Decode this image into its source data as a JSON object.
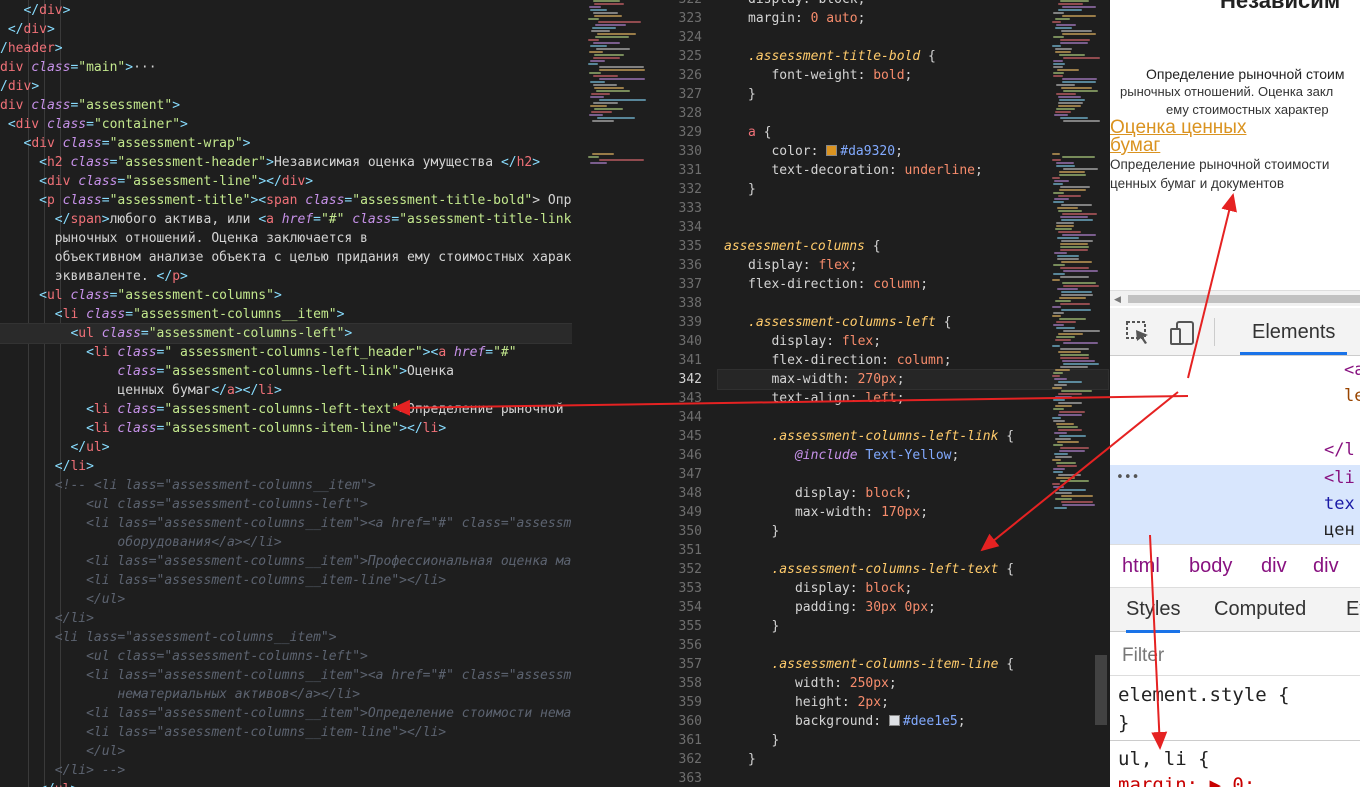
{
  "html_editor": {
    "lines": [
      [
        {
          "t": "   </",
          "c": "pun"
        },
        {
          "t": "div",
          "c": "tag"
        },
        {
          "t": ">",
          "c": "pun"
        }
      ],
      [
        {
          "t": " </",
          "c": "pun"
        },
        {
          "t": "div",
          "c": "tag"
        },
        {
          "t": ">",
          "c": "pun"
        }
      ],
      [
        {
          "t": "/",
          "c": "pun"
        },
        {
          "t": "header",
          "c": "tag"
        },
        {
          "t": ">",
          "c": "pun"
        }
      ],
      [
        {
          "t": "div",
          "c": "tag"
        },
        {
          "t": " class",
          "c": "attr"
        },
        {
          "t": "=",
          "c": "pun"
        },
        {
          "t": "\"main\"",
          "c": "str"
        },
        {
          "t": ">",
          "c": "pun"
        },
        {
          "t": "···",
          "c": "txt"
        }
      ],
      [
        {
          "t": "/",
          "c": "pun"
        },
        {
          "t": "div",
          "c": "tag"
        },
        {
          "t": ">",
          "c": "pun"
        }
      ],
      [
        {
          "t": "div",
          "c": "tag"
        },
        {
          "t": " class",
          "c": "attr"
        },
        {
          "t": "=",
          "c": "pun"
        },
        {
          "t": "\"assessment\"",
          "c": "str"
        },
        {
          "t": ">",
          "c": "pun"
        }
      ],
      [
        {
          "t": " <",
          "c": "pun"
        },
        {
          "t": "div",
          "c": "tag"
        },
        {
          "t": " class",
          "c": "attr"
        },
        {
          "t": "=",
          "c": "pun"
        },
        {
          "t": "\"container\"",
          "c": "str"
        },
        {
          "t": ">",
          "c": "pun"
        }
      ],
      [
        {
          "t": "   <",
          "c": "pun"
        },
        {
          "t": "div",
          "c": "tag"
        },
        {
          "t": " class",
          "c": "attr"
        },
        {
          "t": "=",
          "c": "pun"
        },
        {
          "t": "\"assessment-wrap\"",
          "c": "str"
        },
        {
          "t": ">",
          "c": "pun"
        }
      ],
      [
        {
          "t": "     <",
          "c": "pun"
        },
        {
          "t": "h2",
          "c": "tag"
        },
        {
          "t": " class",
          "c": "attr"
        },
        {
          "t": "=",
          "c": "pun"
        },
        {
          "t": "\"assessment-header\"",
          "c": "str"
        },
        {
          "t": ">",
          "c": "pun"
        },
        {
          "t": "Независимая оценка умущества ",
          "c": "txt"
        },
        {
          "t": "</",
          "c": "pun"
        },
        {
          "t": "h2",
          "c": "tag"
        },
        {
          "t": ">",
          "c": "pun"
        }
      ],
      [
        {
          "t": "     <",
          "c": "pun"
        },
        {
          "t": "div",
          "c": "tag"
        },
        {
          "t": " class",
          "c": "attr"
        },
        {
          "t": "=",
          "c": "pun"
        },
        {
          "t": "\"assessment-line\"",
          "c": "str"
        },
        {
          "t": "></",
          "c": "pun"
        },
        {
          "t": "div",
          "c": "tag"
        },
        {
          "t": ">",
          "c": "pun"
        }
      ],
      [
        {
          "t": "     <",
          "c": "pun"
        },
        {
          "t": "p",
          "c": "tag"
        },
        {
          "t": " class",
          "c": "attr"
        },
        {
          "t": "=",
          "c": "pun"
        },
        {
          "t": "\"assessment-title\"",
          "c": "str"
        },
        {
          "t": "><",
          "c": "pun"
        },
        {
          "t": "span",
          "c": "tag"
        },
        {
          "t": " class",
          "c": "attr"
        },
        {
          "t": "=",
          "c": "pun"
        },
        {
          "t": "\"assessment-title-bold\"",
          "c": "str"
        },
        {
          "t": "> Опре",
          "c": "txt"
        }
      ],
      [
        {
          "t": "       </",
          "c": "pun"
        },
        {
          "t": "span",
          "c": "tag"
        },
        {
          "t": ">",
          "c": "pun"
        },
        {
          "t": "любого актива, или ",
          "c": "txt"
        },
        {
          "t": "<",
          "c": "pun"
        },
        {
          "t": "a",
          "c": "tag"
        },
        {
          "t": " href",
          "c": "attr"
        },
        {
          "t": "=",
          "c": "pun"
        },
        {
          "t": "\"#\"",
          "c": "str"
        },
        {
          "t": " class",
          "c": "attr"
        },
        {
          "t": "=",
          "c": "pun"
        },
        {
          "t": "\"assessment-title-link\"",
          "c": "str"
        }
      ],
      [
        {
          "t": "       рыночных отношений. Оценка заключается в",
          "c": "txt"
        }
      ],
      [
        {
          "t": "       объективном анализе объекта с целью придания ему стоимостных характ",
          "c": "txt"
        }
      ],
      [
        {
          "t": "       эквиваленте. ",
          "c": "txt"
        },
        {
          "t": "</",
          "c": "pun"
        },
        {
          "t": "p",
          "c": "tag"
        },
        {
          "t": ">",
          "c": "pun"
        }
      ],
      [
        {
          "t": "     <",
          "c": "pun"
        },
        {
          "t": "ul",
          "c": "tag"
        },
        {
          "t": " class",
          "c": "attr"
        },
        {
          "t": "=",
          "c": "pun"
        },
        {
          "t": "\"assessment-columns\"",
          "c": "str"
        },
        {
          "t": ">",
          "c": "pun"
        }
      ],
      [
        {
          "t": "       <",
          "c": "pun"
        },
        {
          "t": "li",
          "c": "tag"
        },
        {
          "t": " class",
          "c": "attr"
        },
        {
          "t": "=",
          "c": "pun"
        },
        {
          "t": "\"assessment-columns__item\"",
          "c": "str"
        },
        {
          "t": ">",
          "c": "pun"
        }
      ],
      [
        {
          "t": "         <",
          "c": "pun"
        },
        {
          "t": "ul",
          "c": "tag"
        },
        {
          "t": " class",
          "c": "attr"
        },
        {
          "t": "=",
          "c": "pun"
        },
        {
          "t": "\"assessment-columns-left\"",
          "c": "str"
        },
        {
          "t": ">",
          "c": "pun"
        }
      ],
      [
        {
          "t": "           <",
          "c": "pun"
        },
        {
          "t": "li",
          "c": "tag"
        },
        {
          "t": " class",
          "c": "attr"
        },
        {
          "t": "=",
          "c": "pun"
        },
        {
          "t": "\" assessment-columns-left_header\"",
          "c": "str"
        },
        {
          "t": "><",
          "c": "pun"
        },
        {
          "t": "a",
          "c": "tag"
        },
        {
          "t": " href",
          "c": "attr"
        },
        {
          "t": "=",
          "c": "pun"
        },
        {
          "t": "\"#\"",
          "c": "str"
        }
      ],
      [
        {
          "t": "               class",
          "c": "attr"
        },
        {
          "t": "=",
          "c": "pun"
        },
        {
          "t": "\"assessment-columns-left-link\"",
          "c": "str"
        },
        {
          "t": ">",
          "c": "pun"
        },
        {
          "t": "Оценка",
          "c": "txt"
        }
      ],
      [
        {
          "t": "               ценных бумаг",
          "c": "txt"
        },
        {
          "t": "</",
          "c": "pun"
        },
        {
          "t": "a",
          "c": "tag"
        },
        {
          "t": "></",
          "c": "pun"
        },
        {
          "t": "li",
          "c": "tag"
        },
        {
          "t": ">",
          "c": "pun"
        }
      ],
      [
        {
          "t": "           <",
          "c": "pun"
        },
        {
          "t": "li",
          "c": "tag"
        },
        {
          "t": " class",
          "c": "attr"
        },
        {
          "t": "=",
          "c": "pun"
        },
        {
          "t": "\"assessment-columns-left-text\"",
          "c": "str"
        },
        {
          "t": ">",
          "c": "pun"
        },
        {
          "t": "Определение рыночной с",
          "c": "txt"
        }
      ],
      [
        {
          "t": "           <",
          "c": "pun"
        },
        {
          "t": "li",
          "c": "tag"
        },
        {
          "t": " class",
          "c": "attr"
        },
        {
          "t": "=",
          "c": "pun"
        },
        {
          "t": "\"assessment-columns-item-line\"",
          "c": "str"
        },
        {
          "t": "></",
          "c": "pun"
        },
        {
          "t": "li",
          "c": "tag"
        },
        {
          "t": ">",
          "c": "pun"
        }
      ],
      [
        {
          "t": "         </",
          "c": "pun"
        },
        {
          "t": "ul",
          "c": "tag"
        },
        {
          "t": ">",
          "c": "pun"
        }
      ],
      [
        {
          "t": "       </",
          "c": "pun"
        },
        {
          "t": "li",
          "c": "tag"
        },
        {
          "t": ">",
          "c": "pun"
        }
      ],
      [
        {
          "t": "       <!-- <li lass=\"assessment-columns__item\">",
          "c": "cm"
        }
      ],
      [
        {
          "t": "           <ul class=\"assessment-columns-left\">",
          "c": "cm"
        }
      ],
      [
        {
          "t": "           <li lass=\"assessment-columns__item\"><a href=\"#\" class=\"assessme",
          "c": "cm"
        }
      ],
      [
        {
          "t": "               оборудования</a></li>",
          "c": "cm"
        }
      ],
      [
        {
          "t": "           <li lass=\"assessment-columns__item\">Профессиональная оценка ма",
          "c": "cm"
        }
      ],
      [
        {
          "t": "           <li lass=\"assessment-columns__item-line\"></li>",
          "c": "cm"
        }
      ],
      [
        {
          "t": "           </ul>",
          "c": "cm"
        }
      ],
      [
        {
          "t": "       </li>",
          "c": "cm"
        }
      ],
      [
        {
          "t": "       <li lass=\"assessment-columns__item\">",
          "c": "cm"
        }
      ],
      [
        {
          "t": "           <ul class=\"assessment-columns-left\">",
          "c": "cm"
        }
      ],
      [
        {
          "t": "           <li lass=\"assessment-columns__item\"><a href=\"#\" class=\"assessme",
          "c": "cm"
        }
      ],
      [
        {
          "t": "               нематериальных активов</a></li>",
          "c": "cm"
        }
      ],
      [
        {
          "t": "           <li lass=\"assessment-columns__item\">Определение стоимости нема",
          "c": "cm"
        }
      ],
      [
        {
          "t": "           <li lass=\"assessment-columns__item-line\"></li>",
          "c": "cm"
        }
      ],
      [
        {
          "t": "           </ul>",
          "c": "cm"
        }
      ],
      [
        {
          "t": "       </li> -->",
          "c": "cm"
        }
      ],
      [
        {
          "t": "     </",
          "c": "pun"
        },
        {
          "t": "ul",
          "c": "tag"
        },
        {
          "t": ">",
          "c": "pun"
        }
      ]
    ],
    "highlighted_line": 17
  },
  "css_editor": {
    "line_numbers": [
      "322",
      "323",
      "324",
      "325",
      "326",
      "327",
      "328",
      "329",
      "330",
      "331",
      "332",
      "333",
      "334",
      "335",
      "336",
      "337",
      "338",
      "339",
      "340",
      "341",
      "342",
      "343",
      "344",
      "345",
      "346",
      "347",
      "348",
      "349",
      "350",
      "351",
      "352",
      "353",
      "354",
      "355",
      "356",
      "357",
      "358",
      "359",
      "360",
      "361",
      "362",
      "363"
    ],
    "current_line": "342",
    "lines": [
      [
        {
          "t": "display: block;",
          "c": "prop"
        }
      ],
      [
        {
          "t": "margin: ",
          "c": "prop"
        },
        {
          "t": "0 auto",
          "c": "val"
        },
        {
          "t": ";",
          "c": "prop"
        }
      ],
      [],
      [
        {
          "t": ".assessment-title-bold",
          "c": "sel"
        },
        {
          "t": " {",
          "c": "prop"
        }
      ],
      [
        {
          "t": "   font-weight: ",
          "c": "prop"
        },
        {
          "t": "bold",
          "c": "val"
        },
        {
          "t": ";",
          "c": "prop"
        }
      ],
      [
        {
          "t": "}",
          "c": "prop"
        }
      ],
      [],
      [
        {
          "t": "a",
          "c": "tag"
        },
        {
          "t": " {",
          "c": "prop"
        }
      ],
      [
        {
          "t": "   color: ",
          "c": "prop"
        },
        {
          "t": "#da9320",
          "c": "fn",
          "sw": "#da9320"
        },
        {
          "t": ";",
          "c": "prop"
        }
      ],
      [
        {
          "t": "   text-decoration: ",
          "c": "prop"
        },
        {
          "t": "underline",
          "c": "val"
        },
        {
          "t": ";",
          "c": "prop"
        }
      ],
      [
        {
          "t": "}",
          "c": "prop"
        }
      ],
      [],
      [],
      [
        {
          "t": "assessment-columns",
          "c": "sel",
          "o": -24
        },
        {
          "t": " {",
          "c": "prop"
        }
      ],
      [
        {
          "t": "display: ",
          "c": "prop"
        },
        {
          "t": "flex",
          "c": "val"
        },
        {
          "t": ";",
          "c": "prop"
        }
      ],
      [
        {
          "t": "flex-direction: ",
          "c": "prop"
        },
        {
          "t": "column",
          "c": "val"
        },
        {
          "t": ";",
          "c": "prop"
        }
      ],
      [],
      [
        {
          "t": ".assessment-columns-left",
          "c": "sel"
        },
        {
          "t": " {",
          "c": "prop"
        }
      ],
      [
        {
          "t": "   display: ",
          "c": "prop"
        },
        {
          "t": "flex",
          "c": "val"
        },
        {
          "t": ";",
          "c": "prop"
        }
      ],
      [
        {
          "t": "   flex-direction: ",
          "c": "prop"
        },
        {
          "t": "column",
          "c": "val"
        },
        {
          "t": ";",
          "c": "prop"
        }
      ],
      [
        {
          "t": "   max-width: ",
          "c": "prop"
        },
        {
          "t": "270px",
          "c": "num"
        },
        {
          "t": ";",
          "c": "prop"
        }
      ],
      [
        {
          "t": "   text-align: ",
          "c": "prop"
        },
        {
          "t": "left",
          "c": "val"
        },
        {
          "t": ";",
          "c": "prop"
        }
      ],
      [],
      [
        {
          "t": "   .assessment-columns-left-link",
          "c": "sel"
        },
        {
          "t": " {",
          "c": "prop"
        }
      ],
      [
        {
          "t": "      @include ",
          "c": "inc"
        },
        {
          "t": "Text-Yellow",
          "c": "fn"
        },
        {
          "t": ";",
          "c": "prop"
        }
      ],
      [],
      [
        {
          "t": "      display: ",
          "c": "prop"
        },
        {
          "t": "block",
          "c": "val"
        },
        {
          "t": ";",
          "c": "prop"
        }
      ],
      [
        {
          "t": "      max-width: ",
          "c": "prop"
        },
        {
          "t": "170px",
          "c": "num"
        },
        {
          "t": ";",
          "c": "prop"
        }
      ],
      [
        {
          "t": "   }",
          "c": "prop"
        }
      ],
      [],
      [
        {
          "t": "   .assessment-columns-left-text",
          "c": "sel"
        },
        {
          "t": " {",
          "c": "prop"
        }
      ],
      [
        {
          "t": "      display: ",
          "c": "prop"
        },
        {
          "t": "block",
          "c": "val"
        },
        {
          "t": ";",
          "c": "prop"
        }
      ],
      [
        {
          "t": "      padding: ",
          "c": "prop"
        },
        {
          "t": "30px 0px",
          "c": "num"
        },
        {
          "t": ";",
          "c": "prop"
        }
      ],
      [
        {
          "t": "   }",
          "c": "prop"
        }
      ],
      [],
      [
        {
          "t": "   .assessment-columns-item-line",
          "c": "sel"
        },
        {
          "t": " {",
          "c": "prop"
        }
      ],
      [
        {
          "t": "      width: ",
          "c": "prop"
        },
        {
          "t": "250px",
          "c": "num"
        },
        {
          "t": ";",
          "c": "prop"
        }
      ],
      [
        {
          "t": "      height: ",
          "c": "prop"
        },
        {
          "t": "2px",
          "c": "num"
        },
        {
          "t": ";",
          "c": "prop"
        }
      ],
      [
        {
          "t": "      background: ",
          "c": "prop"
        },
        {
          "t": "#dee1e5",
          "c": "fn",
          "sw": "#dee1e5"
        },
        {
          "t": ";",
          "c": "prop"
        }
      ],
      [
        {
          "t": "   }",
          "c": "prop"
        }
      ],
      [
        {
          "t": "}",
          "c": "prop"
        }
      ],
      []
    ]
  },
  "browser_page": {
    "title": "Независим",
    "bold_line": "Определение рыночной стоим",
    "text_line_1": "рыночных отношений. Оценка закл",
    "text_line_2": "ему стоимостных характер",
    "link": "Оценка ценных бумаг",
    "link_color": "#da9320",
    "desc": "Определение рыночной стоимости ценных бумаг и документов"
  },
  "devtools": {
    "tab_elements": "Elements",
    "dom_rows": [
      "<a",
      "le",
      "</l",
      "<li",
      "tex",
      "цен"
    ],
    "dots": "•••",
    "breadcrumbs": [
      "html",
      "body",
      "div",
      "div"
    ],
    "styles_tab": "Styles",
    "computed_tab": "Computed",
    "more_tab": "Ev",
    "filter_placeholder": "Filter",
    "rule_element_style": "element.style {",
    "rule_close": "}",
    "rule_ul_li": "ul, li {",
    "rule_margin": "margin: ▶ 0;"
  },
  "colors": {
    "editor_bg": "#1e1e1e",
    "arrow": "#e52222",
    "selected_dom": "#d8e6fd",
    "accent_blue": "#1a73e8"
  }
}
